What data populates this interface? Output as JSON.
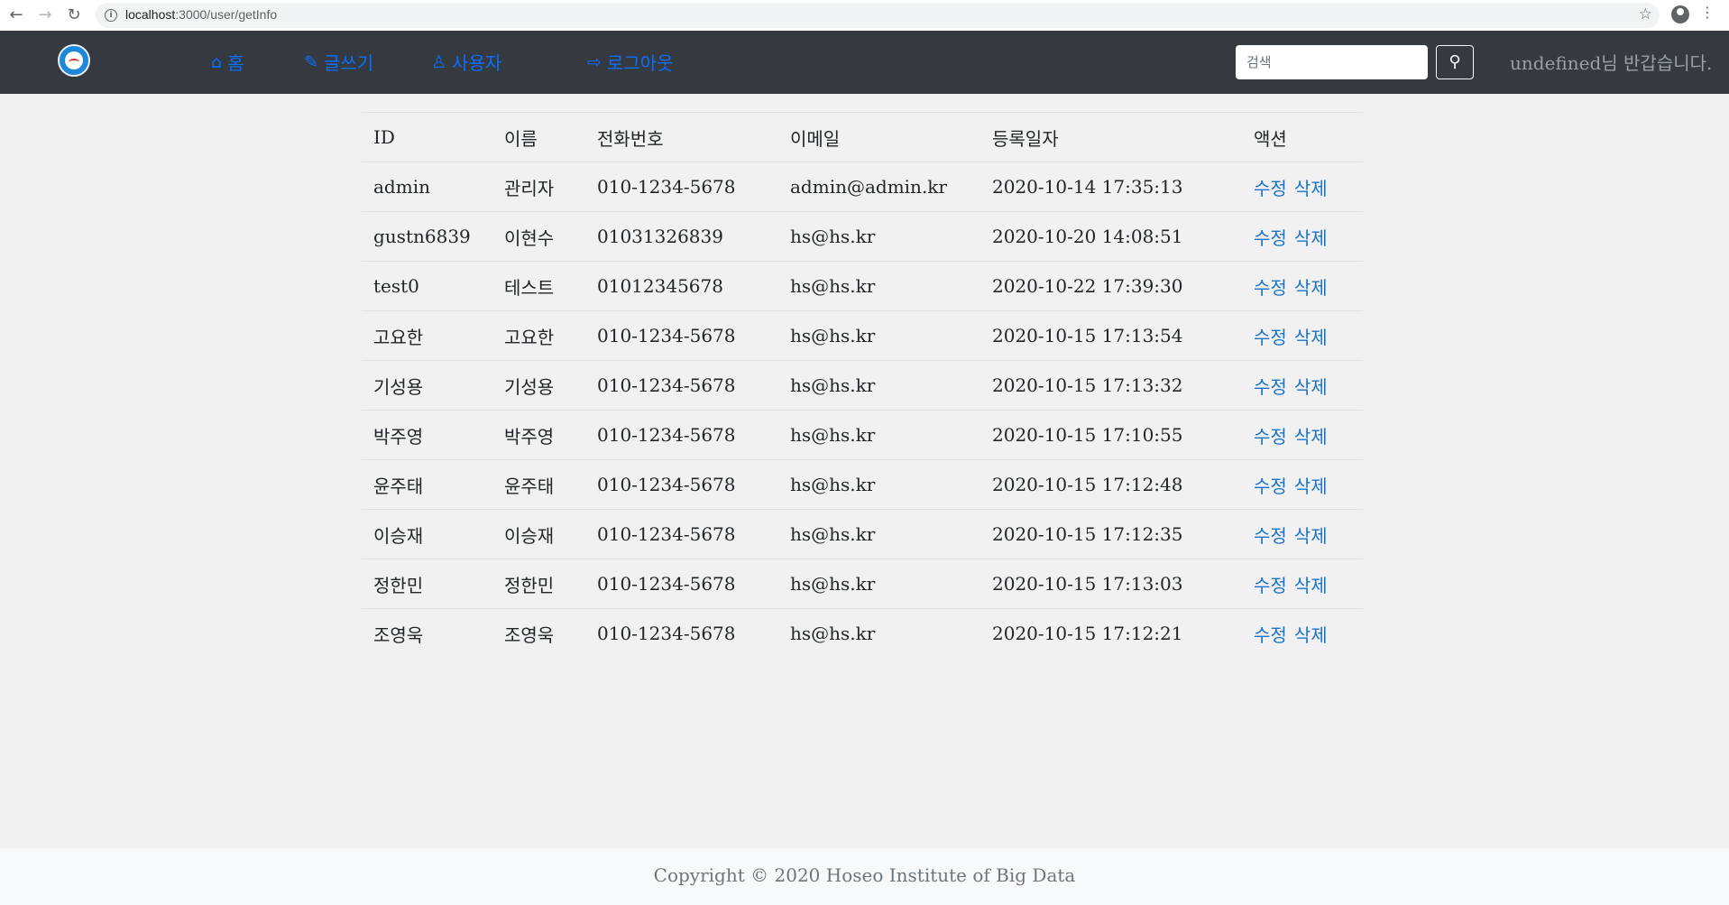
{
  "browser": {
    "url_host": "localhost",
    "url_path": ":3000/user/getInfo"
  },
  "navbar": {
    "home_label": "홈",
    "write_label": "글쓰기",
    "users_label": "사용자",
    "logout_label": "로그아웃",
    "search_placeholder": "검색",
    "welcome": "undefined님 반갑습니다."
  },
  "table": {
    "headers": [
      "ID",
      "이름",
      "전화번호",
      "이메일",
      "등록일자",
      "액션"
    ],
    "rows": [
      {
        "id": "admin",
        "name": "관리자",
        "phone": "010-1234-5678",
        "email": "admin@admin.kr",
        "date": "2020-10-14 17:35:13"
      },
      {
        "id": "gustn6839",
        "name": "이현수",
        "phone": "01031326839",
        "email": "hs@hs.kr",
        "date": "2020-10-20 14:08:51"
      },
      {
        "id": "test0",
        "name": "테스트",
        "phone": "01012345678",
        "email": "hs@hs.kr",
        "date": "2020-10-22 17:39:30"
      },
      {
        "id": "고요한",
        "name": "고요한",
        "phone": "010-1234-5678",
        "email": "hs@hs.kr",
        "date": "2020-10-15 17:13:54"
      },
      {
        "id": "기성용",
        "name": "기성용",
        "phone": "010-1234-5678",
        "email": "hs@hs.kr",
        "date": "2020-10-15 17:13:32"
      },
      {
        "id": "박주영",
        "name": "박주영",
        "phone": "010-1234-5678",
        "email": "hs@hs.kr",
        "date": "2020-10-15 17:10:55"
      },
      {
        "id": "윤주태",
        "name": "윤주태",
        "phone": "010-1234-5678",
        "email": "hs@hs.kr",
        "date": "2020-10-15 17:12:48"
      },
      {
        "id": "이승재",
        "name": "이승재",
        "phone": "010-1234-5678",
        "email": "hs@hs.kr",
        "date": "2020-10-15 17:12:35"
      },
      {
        "id": "정한민",
        "name": "정한민",
        "phone": "010-1234-5678",
        "email": "hs@hs.kr",
        "date": "2020-10-15 17:13:03"
      },
      {
        "id": "조영욱",
        "name": "조영욱",
        "phone": "010-1234-5678",
        "email": "hs@hs.kr",
        "date": "2020-10-15 17:12:21"
      }
    ],
    "edit_label": "수정",
    "delete_label": "삭제"
  },
  "footer": {
    "copyright": "Copyright © 2020 Hoseo Institute of Big Data"
  },
  "colors": {
    "navbar_bg": "#343a40",
    "link": "#0d6efd",
    "action_link": "#1a73c9"
  }
}
